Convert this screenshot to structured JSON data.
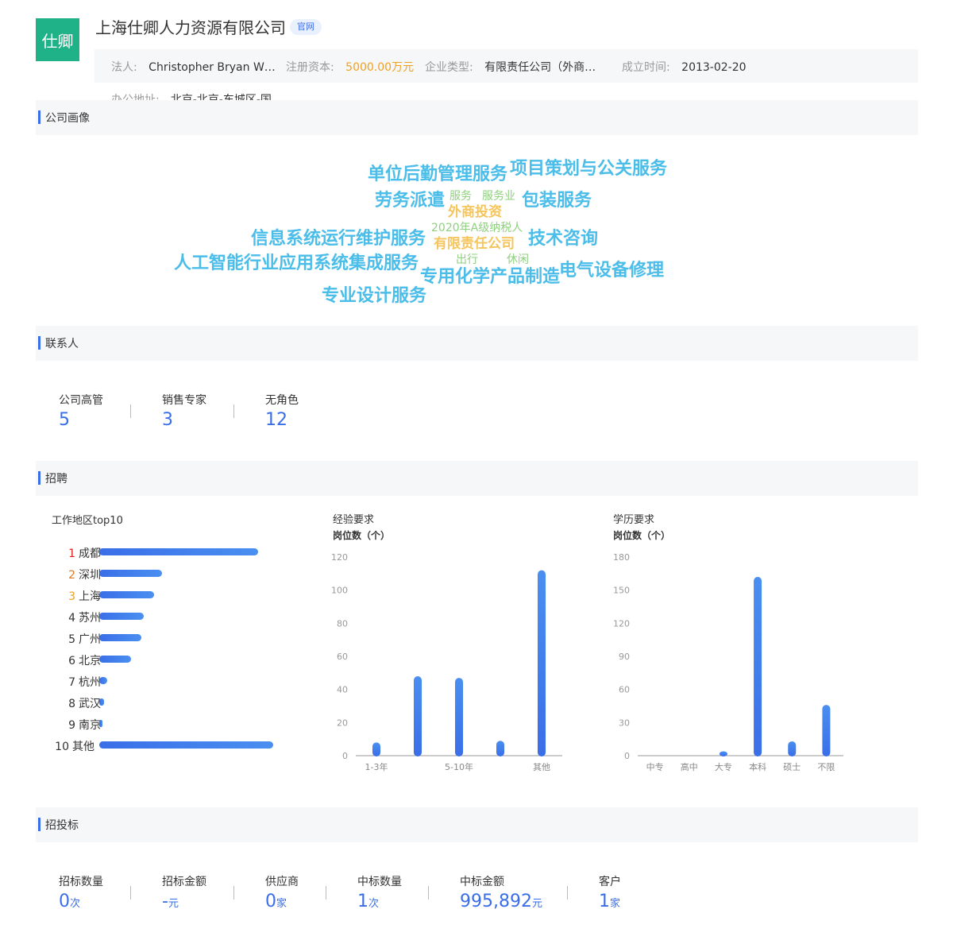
{
  "header": {
    "logo_text": "仕卿",
    "company_name": "上海仕卿人力资源有限公司",
    "official_site_badge": "官网",
    "legal_rep_label": "法人:",
    "legal_rep_value": "Christopher Bryan W…",
    "reg_capital_label": "注册资本:",
    "reg_capital_value": "5000.00万元",
    "company_type_label": "企业类型:",
    "company_type_value": "有限责任公司（外商…",
    "established_label": "成立时间:",
    "established_value": "2013-02-20",
    "office_address_label": "办公地址:",
    "office_address_value": "北京-北京-东城区-国"
  },
  "colors": {
    "accent": "#3a6ee8",
    "logo_bg": "#1fb289",
    "orange": "#f0a020",
    "cloud_blue": "#4bbde9",
    "cloud_green": "#8fd07e",
    "cloud_yellow": "#f5c55d"
  },
  "sections": {
    "portrait": "公司画像",
    "contacts": "联系人",
    "recruit": "招聘",
    "bidding": "招投标"
  },
  "word_cloud": [
    {
      "text": "单位后勤管理服务",
      "color": "blue"
    },
    {
      "text": "项目策划与公关服务",
      "color": "blue"
    },
    {
      "text": "劳务派遣",
      "color": "blue"
    },
    {
      "text": "服务",
      "color": "green"
    },
    {
      "text": "服务业",
      "color": "green"
    },
    {
      "text": "包装服务",
      "color": "blue"
    },
    {
      "text": "外商投资",
      "color": "yellow"
    },
    {
      "text": "2020年A级纳税人",
      "color": "green"
    },
    {
      "text": "信息系统运行维护服务",
      "color": "blue"
    },
    {
      "text": "有限责任公司",
      "color": "yellow"
    },
    {
      "text": "技术咨询",
      "color": "blue"
    },
    {
      "text": "出行",
      "color": "green"
    },
    {
      "text": "休闲",
      "color": "green"
    },
    {
      "text": "人工智能行业应用系统集成服务",
      "color": "blue"
    },
    {
      "text": "专用化学产品制造",
      "color": "blue"
    },
    {
      "text": "电气设备修理",
      "color": "blue"
    },
    {
      "text": "专业设计服务",
      "color": "blue"
    }
  ],
  "contacts": [
    {
      "label": "公司高管",
      "value": "5"
    },
    {
      "label": "销售专家",
      "value": "3"
    },
    {
      "label": "无角色",
      "value": "12"
    }
  ],
  "recruit": {
    "region_title": "工作地区top10",
    "experience_title": "经验要求",
    "education_title": "学历要求",
    "y_axis_label": "岗位数（个）"
  },
  "chart_data": [
    {
      "type": "bar",
      "title": "工作地区top10",
      "orientation": "horizontal",
      "categories": [
        "成都",
        "深圳",
        "上海",
        "苏州",
        "广州",
        "北京",
        "杭州",
        "武汉",
        "南京",
        "其他"
      ],
      "ranks": [
        "1",
        "2",
        "3",
        "4",
        "5",
        "6",
        "7",
        "8",
        "9",
        "10"
      ],
      "rank_colors": [
        "#e02020",
        "#e07a20",
        "#f0a020",
        "#333333",
        "#333333",
        "#333333",
        "#333333",
        "#333333",
        "#333333",
        "#333333"
      ],
      "values": [
        200,
        79,
        69,
        56,
        53,
        40,
        10,
        6,
        3,
        219
      ]
    },
    {
      "type": "bar",
      "title": "经验要求",
      "ylabel": "岗位数（个）",
      "categories": [
        "1-3年",
        "",
        "5-10年",
        "",
        "其他"
      ],
      "values": [
        8,
        48,
        47,
        9,
        112
      ],
      "ylim": [
        0,
        120
      ],
      "yticks": [
        0,
        20,
        40,
        60,
        80,
        100,
        120
      ]
    },
    {
      "type": "bar",
      "title": "学历要求",
      "ylabel": "岗位数（个）",
      "categories": [
        "中专",
        "高中",
        "大专",
        "本科",
        "硕士",
        "不限"
      ],
      "values": [
        0,
        0,
        4,
        162,
        13,
        46
      ],
      "ylim": [
        0,
        180
      ],
      "yticks": [
        0,
        30,
        60,
        90,
        120,
        150,
        180
      ]
    }
  ],
  "bidding": [
    {
      "label": "招标数量",
      "value": "0",
      "unit": "次"
    },
    {
      "label": "招标金额",
      "value": "-",
      "unit": "元"
    },
    {
      "label": "供应商",
      "value": "0",
      "unit": "家"
    },
    {
      "label": "中标数量",
      "value": "1",
      "unit": "次"
    },
    {
      "label": "中标金额",
      "value": "995,892",
      "unit": "元"
    },
    {
      "label": "客户",
      "value": "1",
      "unit": "家"
    }
  ]
}
